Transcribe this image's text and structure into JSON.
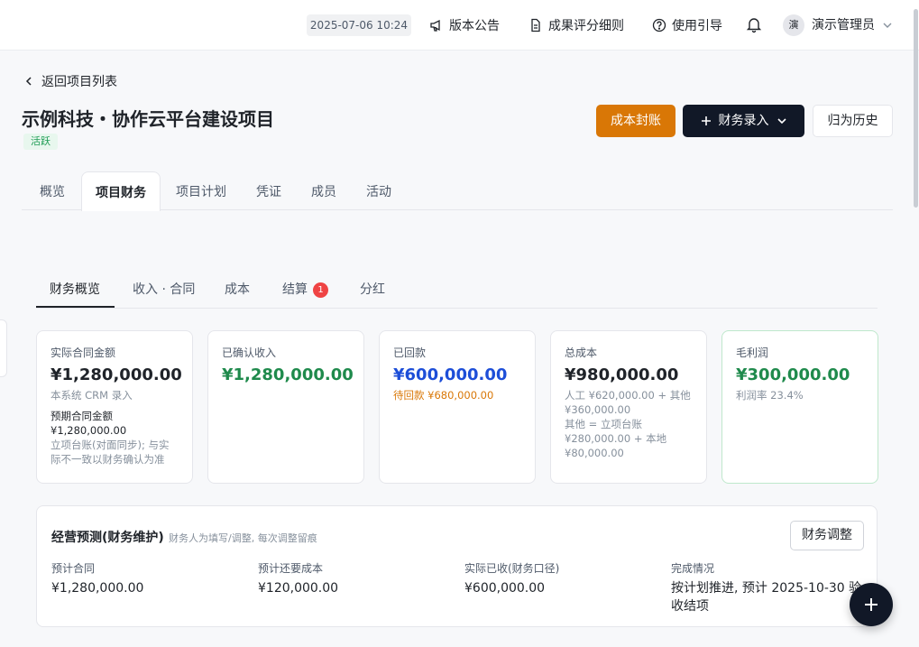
{
  "topbar": {
    "datetime": "2025-07-06 10:24",
    "announcements": "版本公告",
    "scoring_rules": "成果评分细则",
    "guide": "使用引导",
    "avatar_initial": "演",
    "username": "演示管理员"
  },
  "header": {
    "back_label": "返回项目列表",
    "title": "示例科技・协作云平台建设项目",
    "status": "活跃",
    "actions": {
      "cost_seal": "成本封账",
      "finance_entry": "财务录入",
      "archive": "归为历史"
    }
  },
  "main_tabs": [
    "概览",
    "项目财务",
    "项目计划",
    "凭证",
    "成员",
    "活动"
  ],
  "finance_tabs": [
    "财务概览",
    "收入 · 合同",
    "成本",
    "结算",
    "分红"
  ],
  "settlement_count": "1",
  "cards": {
    "contract": {
      "label": "实际合同金额",
      "value": "¥1,280,000.00",
      "source": "本系统 CRM 录入",
      "expected_label": "预期合同金额",
      "expected_value": "¥1,280,000.00",
      "note": "立项台账(对面同步); 与实际不一致以财务确认为准"
    },
    "confirmed": {
      "label": "已确认收入",
      "value": "¥1,280,000.00"
    },
    "collected": {
      "label": "已回款",
      "value": "¥600,000.00",
      "pending": "待回款 ¥680,000.00"
    },
    "total_cost": {
      "label": "总成本",
      "value": "¥980,000.00",
      "breakdown": "人工 ¥620,000.00 + 其他 ¥360,000.00",
      "other_breakdown": "其他 = 立项台账 ¥280,000.00 + 本地 ¥80,000.00"
    },
    "gross_profit": {
      "label": "毛利润",
      "value": "¥300,000.00",
      "margin": "利润率 23.4%"
    }
  },
  "forecast": {
    "title": "经营预测(财务维护)",
    "note": "财务人为填写/调整, 每次调整留痕",
    "adjust_button": "财务调整",
    "items": [
      {
        "label": "预计合同",
        "value": "¥1,280,000.00"
      },
      {
        "label": "预计还要成本",
        "value": "¥120,000.00"
      },
      {
        "label": "实际已收(财务口径)",
        "value": "¥600,000.00"
      },
      {
        "label": "完成情况",
        "value": "按计划推进, 预计 2025-10-30 验收结项"
      }
    ]
  },
  "colors": {
    "accent_orange": "#d97706",
    "dark_button": "#111827",
    "green_value": "#1f8a4c",
    "blue_value": "#1d4ed8",
    "badge_red": "#ef4444"
  }
}
